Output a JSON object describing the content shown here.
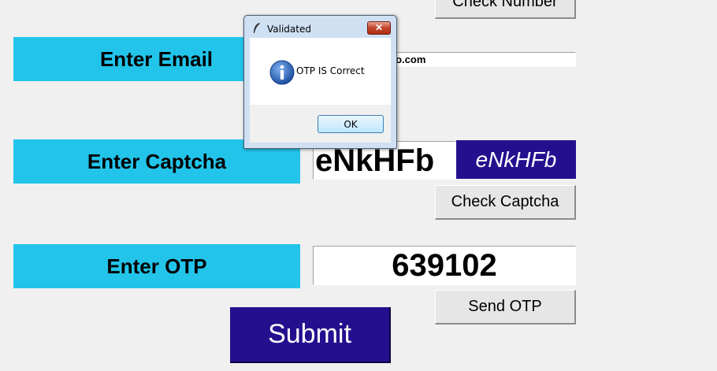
{
  "form": {
    "check_number_label": "Check Number",
    "email_label": "Enter Email",
    "email_value": "yushseth@yahoo.com",
    "captcha_label": "Enter Captcha",
    "captcha_input_value": "eNkHFb",
    "captcha_display": "eNkHFb",
    "check_captcha_label": "Check Captcha",
    "otp_label": "Enter OTP",
    "otp_value": "639102",
    "send_otp_label": "Send OTP",
    "submit_label": "Submit"
  },
  "dialog": {
    "title": "Validated",
    "message": "OTP IS Correct",
    "ok_label": "OK",
    "close_glyph": "✕"
  },
  "colors": {
    "label_bg": "#22c4ea",
    "accent_purple": "#24108f"
  }
}
